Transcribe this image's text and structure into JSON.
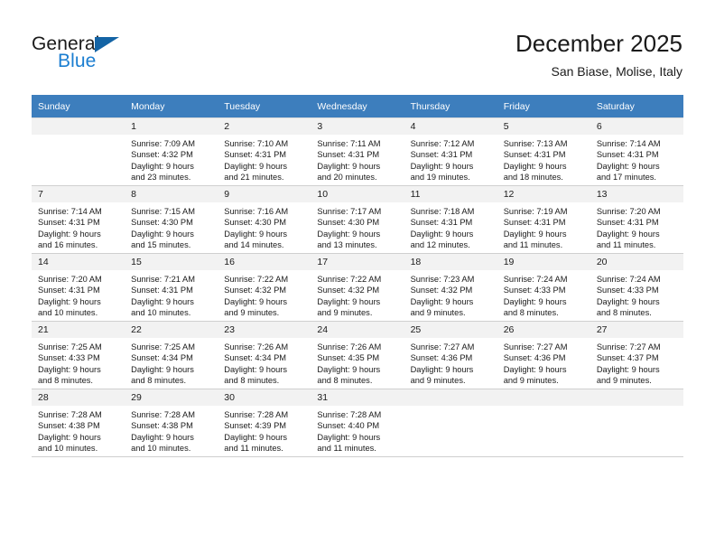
{
  "brand": {
    "name_part1": "General",
    "name_part2": "Blue",
    "accent_color": "#1464a5",
    "blue_text_color": "#1b7ed1",
    "logo_icon": "triangle-logo-icon"
  },
  "header": {
    "title": "December 2025",
    "subtitle": "San Biase, Molise, Italy"
  },
  "calendar": {
    "header_background": "#3d7ebd",
    "daynum_background": "#f2f2f2",
    "weekday_headers": [
      "Sunday",
      "Monday",
      "Tuesday",
      "Wednesday",
      "Thursday",
      "Friday",
      "Saturday"
    ],
    "weeks": [
      [
        {
          "day": "",
          "empty": true,
          "sunrise": "",
          "sunset": "",
          "daylight_line1": "",
          "daylight_line2": ""
        },
        {
          "day": "1",
          "sunrise": "Sunrise: 7:09 AM",
          "sunset": "Sunset: 4:32 PM",
          "daylight_line1": "Daylight: 9 hours",
          "daylight_line2": "and 23 minutes."
        },
        {
          "day": "2",
          "sunrise": "Sunrise: 7:10 AM",
          "sunset": "Sunset: 4:31 PM",
          "daylight_line1": "Daylight: 9 hours",
          "daylight_line2": "and 21 minutes."
        },
        {
          "day": "3",
          "sunrise": "Sunrise: 7:11 AM",
          "sunset": "Sunset: 4:31 PM",
          "daylight_line1": "Daylight: 9 hours",
          "daylight_line2": "and 20 minutes."
        },
        {
          "day": "4",
          "sunrise": "Sunrise: 7:12 AM",
          "sunset": "Sunset: 4:31 PM",
          "daylight_line1": "Daylight: 9 hours",
          "daylight_line2": "and 19 minutes."
        },
        {
          "day": "5",
          "sunrise": "Sunrise: 7:13 AM",
          "sunset": "Sunset: 4:31 PM",
          "daylight_line1": "Daylight: 9 hours",
          "daylight_line2": "and 18 minutes."
        },
        {
          "day": "6",
          "sunrise": "Sunrise: 7:14 AM",
          "sunset": "Sunset: 4:31 PM",
          "daylight_line1": "Daylight: 9 hours",
          "daylight_line2": "and 17 minutes."
        }
      ],
      [
        {
          "day": "7",
          "sunrise": "Sunrise: 7:14 AM",
          "sunset": "Sunset: 4:31 PM",
          "daylight_line1": "Daylight: 9 hours",
          "daylight_line2": "and 16 minutes."
        },
        {
          "day": "8",
          "sunrise": "Sunrise: 7:15 AM",
          "sunset": "Sunset: 4:30 PM",
          "daylight_line1": "Daylight: 9 hours",
          "daylight_line2": "and 15 minutes."
        },
        {
          "day": "9",
          "sunrise": "Sunrise: 7:16 AM",
          "sunset": "Sunset: 4:30 PM",
          "daylight_line1": "Daylight: 9 hours",
          "daylight_line2": "and 14 minutes."
        },
        {
          "day": "10",
          "sunrise": "Sunrise: 7:17 AM",
          "sunset": "Sunset: 4:30 PM",
          "daylight_line1": "Daylight: 9 hours",
          "daylight_line2": "and 13 minutes."
        },
        {
          "day": "11",
          "sunrise": "Sunrise: 7:18 AM",
          "sunset": "Sunset: 4:31 PM",
          "daylight_line1": "Daylight: 9 hours",
          "daylight_line2": "and 12 minutes."
        },
        {
          "day": "12",
          "sunrise": "Sunrise: 7:19 AM",
          "sunset": "Sunset: 4:31 PM",
          "daylight_line1": "Daylight: 9 hours",
          "daylight_line2": "and 11 minutes."
        },
        {
          "day": "13",
          "sunrise": "Sunrise: 7:20 AM",
          "sunset": "Sunset: 4:31 PM",
          "daylight_line1": "Daylight: 9 hours",
          "daylight_line2": "and 11 minutes."
        }
      ],
      [
        {
          "day": "14",
          "sunrise": "Sunrise: 7:20 AM",
          "sunset": "Sunset: 4:31 PM",
          "daylight_line1": "Daylight: 9 hours",
          "daylight_line2": "and 10 minutes."
        },
        {
          "day": "15",
          "sunrise": "Sunrise: 7:21 AM",
          "sunset": "Sunset: 4:31 PM",
          "daylight_line1": "Daylight: 9 hours",
          "daylight_line2": "and 10 minutes."
        },
        {
          "day": "16",
          "sunrise": "Sunrise: 7:22 AM",
          "sunset": "Sunset: 4:32 PM",
          "daylight_line1": "Daylight: 9 hours",
          "daylight_line2": "and 9 minutes."
        },
        {
          "day": "17",
          "sunrise": "Sunrise: 7:22 AM",
          "sunset": "Sunset: 4:32 PM",
          "daylight_line1": "Daylight: 9 hours",
          "daylight_line2": "and 9 minutes."
        },
        {
          "day": "18",
          "sunrise": "Sunrise: 7:23 AM",
          "sunset": "Sunset: 4:32 PM",
          "daylight_line1": "Daylight: 9 hours",
          "daylight_line2": "and 9 minutes."
        },
        {
          "day": "19",
          "sunrise": "Sunrise: 7:24 AM",
          "sunset": "Sunset: 4:33 PM",
          "daylight_line1": "Daylight: 9 hours",
          "daylight_line2": "and 8 minutes."
        },
        {
          "day": "20",
          "sunrise": "Sunrise: 7:24 AM",
          "sunset": "Sunset: 4:33 PM",
          "daylight_line1": "Daylight: 9 hours",
          "daylight_line2": "and 8 minutes."
        }
      ],
      [
        {
          "day": "21",
          "sunrise": "Sunrise: 7:25 AM",
          "sunset": "Sunset: 4:33 PM",
          "daylight_line1": "Daylight: 9 hours",
          "daylight_line2": "and 8 minutes."
        },
        {
          "day": "22",
          "sunrise": "Sunrise: 7:25 AM",
          "sunset": "Sunset: 4:34 PM",
          "daylight_line1": "Daylight: 9 hours",
          "daylight_line2": "and 8 minutes."
        },
        {
          "day": "23",
          "sunrise": "Sunrise: 7:26 AM",
          "sunset": "Sunset: 4:34 PM",
          "daylight_line1": "Daylight: 9 hours",
          "daylight_line2": "and 8 minutes."
        },
        {
          "day": "24",
          "sunrise": "Sunrise: 7:26 AM",
          "sunset": "Sunset: 4:35 PM",
          "daylight_line1": "Daylight: 9 hours",
          "daylight_line2": "and 8 minutes."
        },
        {
          "day": "25",
          "sunrise": "Sunrise: 7:27 AM",
          "sunset": "Sunset: 4:36 PM",
          "daylight_line1": "Daylight: 9 hours",
          "daylight_line2": "and 9 minutes."
        },
        {
          "day": "26",
          "sunrise": "Sunrise: 7:27 AM",
          "sunset": "Sunset: 4:36 PM",
          "daylight_line1": "Daylight: 9 hours",
          "daylight_line2": "and 9 minutes."
        },
        {
          "day": "27",
          "sunrise": "Sunrise: 7:27 AM",
          "sunset": "Sunset: 4:37 PM",
          "daylight_line1": "Daylight: 9 hours",
          "daylight_line2": "and 9 minutes."
        }
      ],
      [
        {
          "day": "28",
          "sunrise": "Sunrise: 7:28 AM",
          "sunset": "Sunset: 4:38 PM",
          "daylight_line1": "Daylight: 9 hours",
          "daylight_line2": "and 10 minutes."
        },
        {
          "day": "29",
          "sunrise": "Sunrise: 7:28 AM",
          "sunset": "Sunset: 4:38 PM",
          "daylight_line1": "Daylight: 9 hours",
          "daylight_line2": "and 10 minutes."
        },
        {
          "day": "30",
          "sunrise": "Sunrise: 7:28 AM",
          "sunset": "Sunset: 4:39 PM",
          "daylight_line1": "Daylight: 9 hours",
          "daylight_line2": "and 11 minutes."
        },
        {
          "day": "31",
          "sunrise": "Sunrise: 7:28 AM",
          "sunset": "Sunset: 4:40 PM",
          "daylight_line1": "Daylight: 9 hours",
          "daylight_line2": "and 11 minutes."
        },
        {
          "day": "",
          "empty": true,
          "sunrise": "",
          "sunset": "",
          "daylight_line1": "",
          "daylight_line2": ""
        },
        {
          "day": "",
          "empty": true,
          "sunrise": "",
          "sunset": "",
          "daylight_line1": "",
          "daylight_line2": ""
        },
        {
          "day": "",
          "empty": true,
          "sunrise": "",
          "sunset": "",
          "daylight_line1": "",
          "daylight_line2": ""
        }
      ]
    ]
  }
}
